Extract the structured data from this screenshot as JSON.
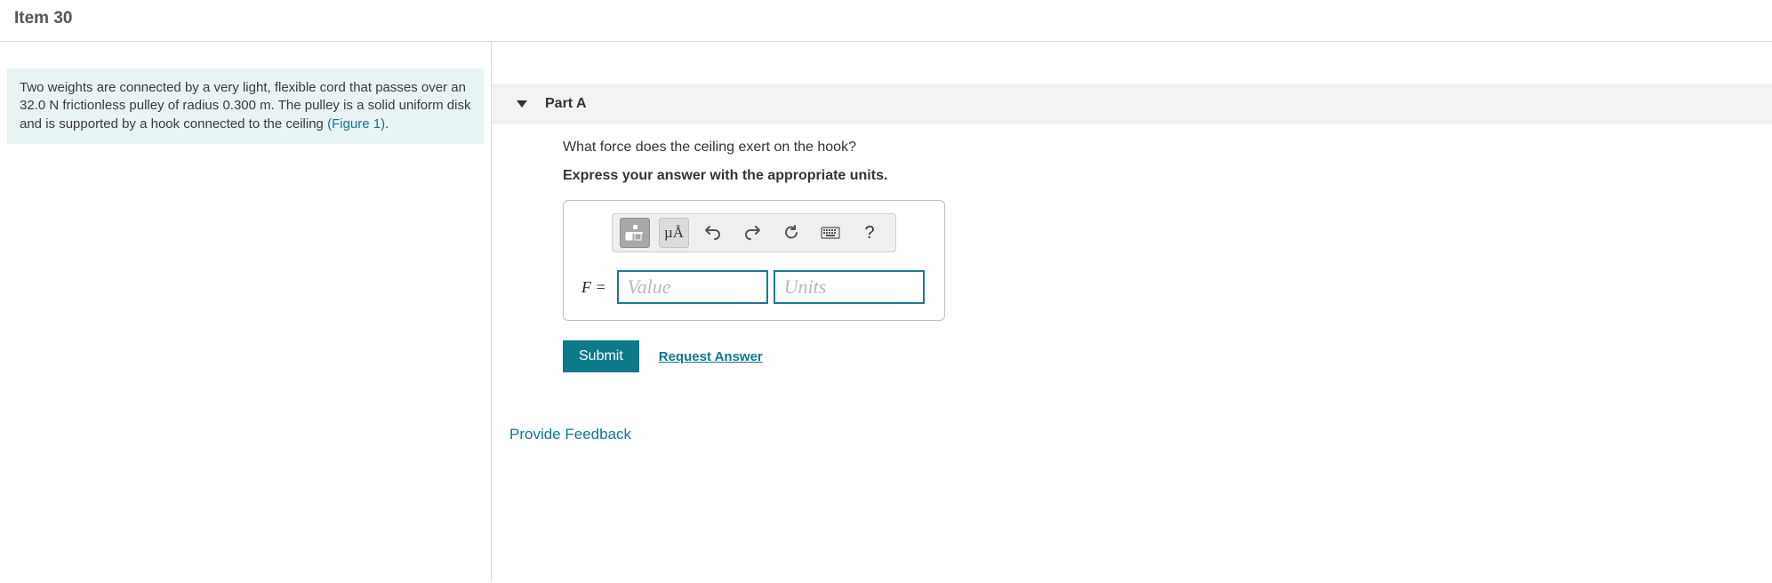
{
  "header": {
    "title": "Item 30"
  },
  "problem": {
    "text_html": "Two weights are connected by a very light, flexible cord that passes over an 32.0 N frictionless pulley of radius 0.300 m. The pulley is a solid uniform disk and is supported by a hook connected to the ceiling ",
    "figure_link": "(Figure 1)"
  },
  "part": {
    "label": "Part A",
    "question": "What force does the ceiling exert on the hook?",
    "instruction": "Express your answer with the appropriate units.",
    "variable": "F =",
    "value_placeholder": "Value",
    "units_placeholder": "Units",
    "toolbar": {
      "templates": "templates-icon",
      "units_btn": "µÅ",
      "undo": "undo-icon",
      "redo": "redo-icon",
      "reset": "reset-icon",
      "keyboard": "keyboard-icon",
      "help": "?"
    },
    "submit_label": "Submit",
    "request_label": "Request Answer"
  },
  "feedback_label": "Provide Feedback"
}
